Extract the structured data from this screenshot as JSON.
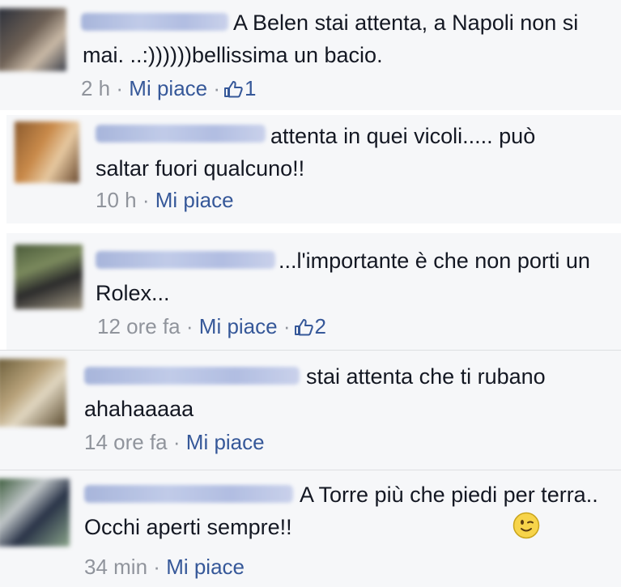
{
  "comments": [
    {
      "text": "A Belen stai attenta, a Napoli non si mai. ..:))))))bellissima un bacio.",
      "time": "2 h",
      "like_label": "Mi piace",
      "like_count": "1"
    },
    {
      "text": "attenta in quei vicoli..... può saltar fuori qualcuno!!",
      "time": "10 h",
      "like_label": "Mi piace"
    },
    {
      "text": "...l'importante è che non porti un Rolex...",
      "time": "12 ore fa",
      "like_label": "Mi piace",
      "like_count": "2"
    },
    {
      "text": "stai attenta che ti rubano ahahaaaaa",
      "time": "14 ore fa",
      "like_label": "Mi piace"
    },
    {
      "text": "A Torre più che piedi per terra.. Occhi aperti sempre!!",
      "time": "34 min",
      "like_label": "Mi piace"
    }
  ],
  "separator": "·",
  "icons": {
    "like": "thumbs-up-icon",
    "emoji": "wink-smiley-icon"
  },
  "colors": {
    "link": "#365899",
    "meta": "#90949c",
    "text": "#141823",
    "background": "#f6f7f9"
  }
}
